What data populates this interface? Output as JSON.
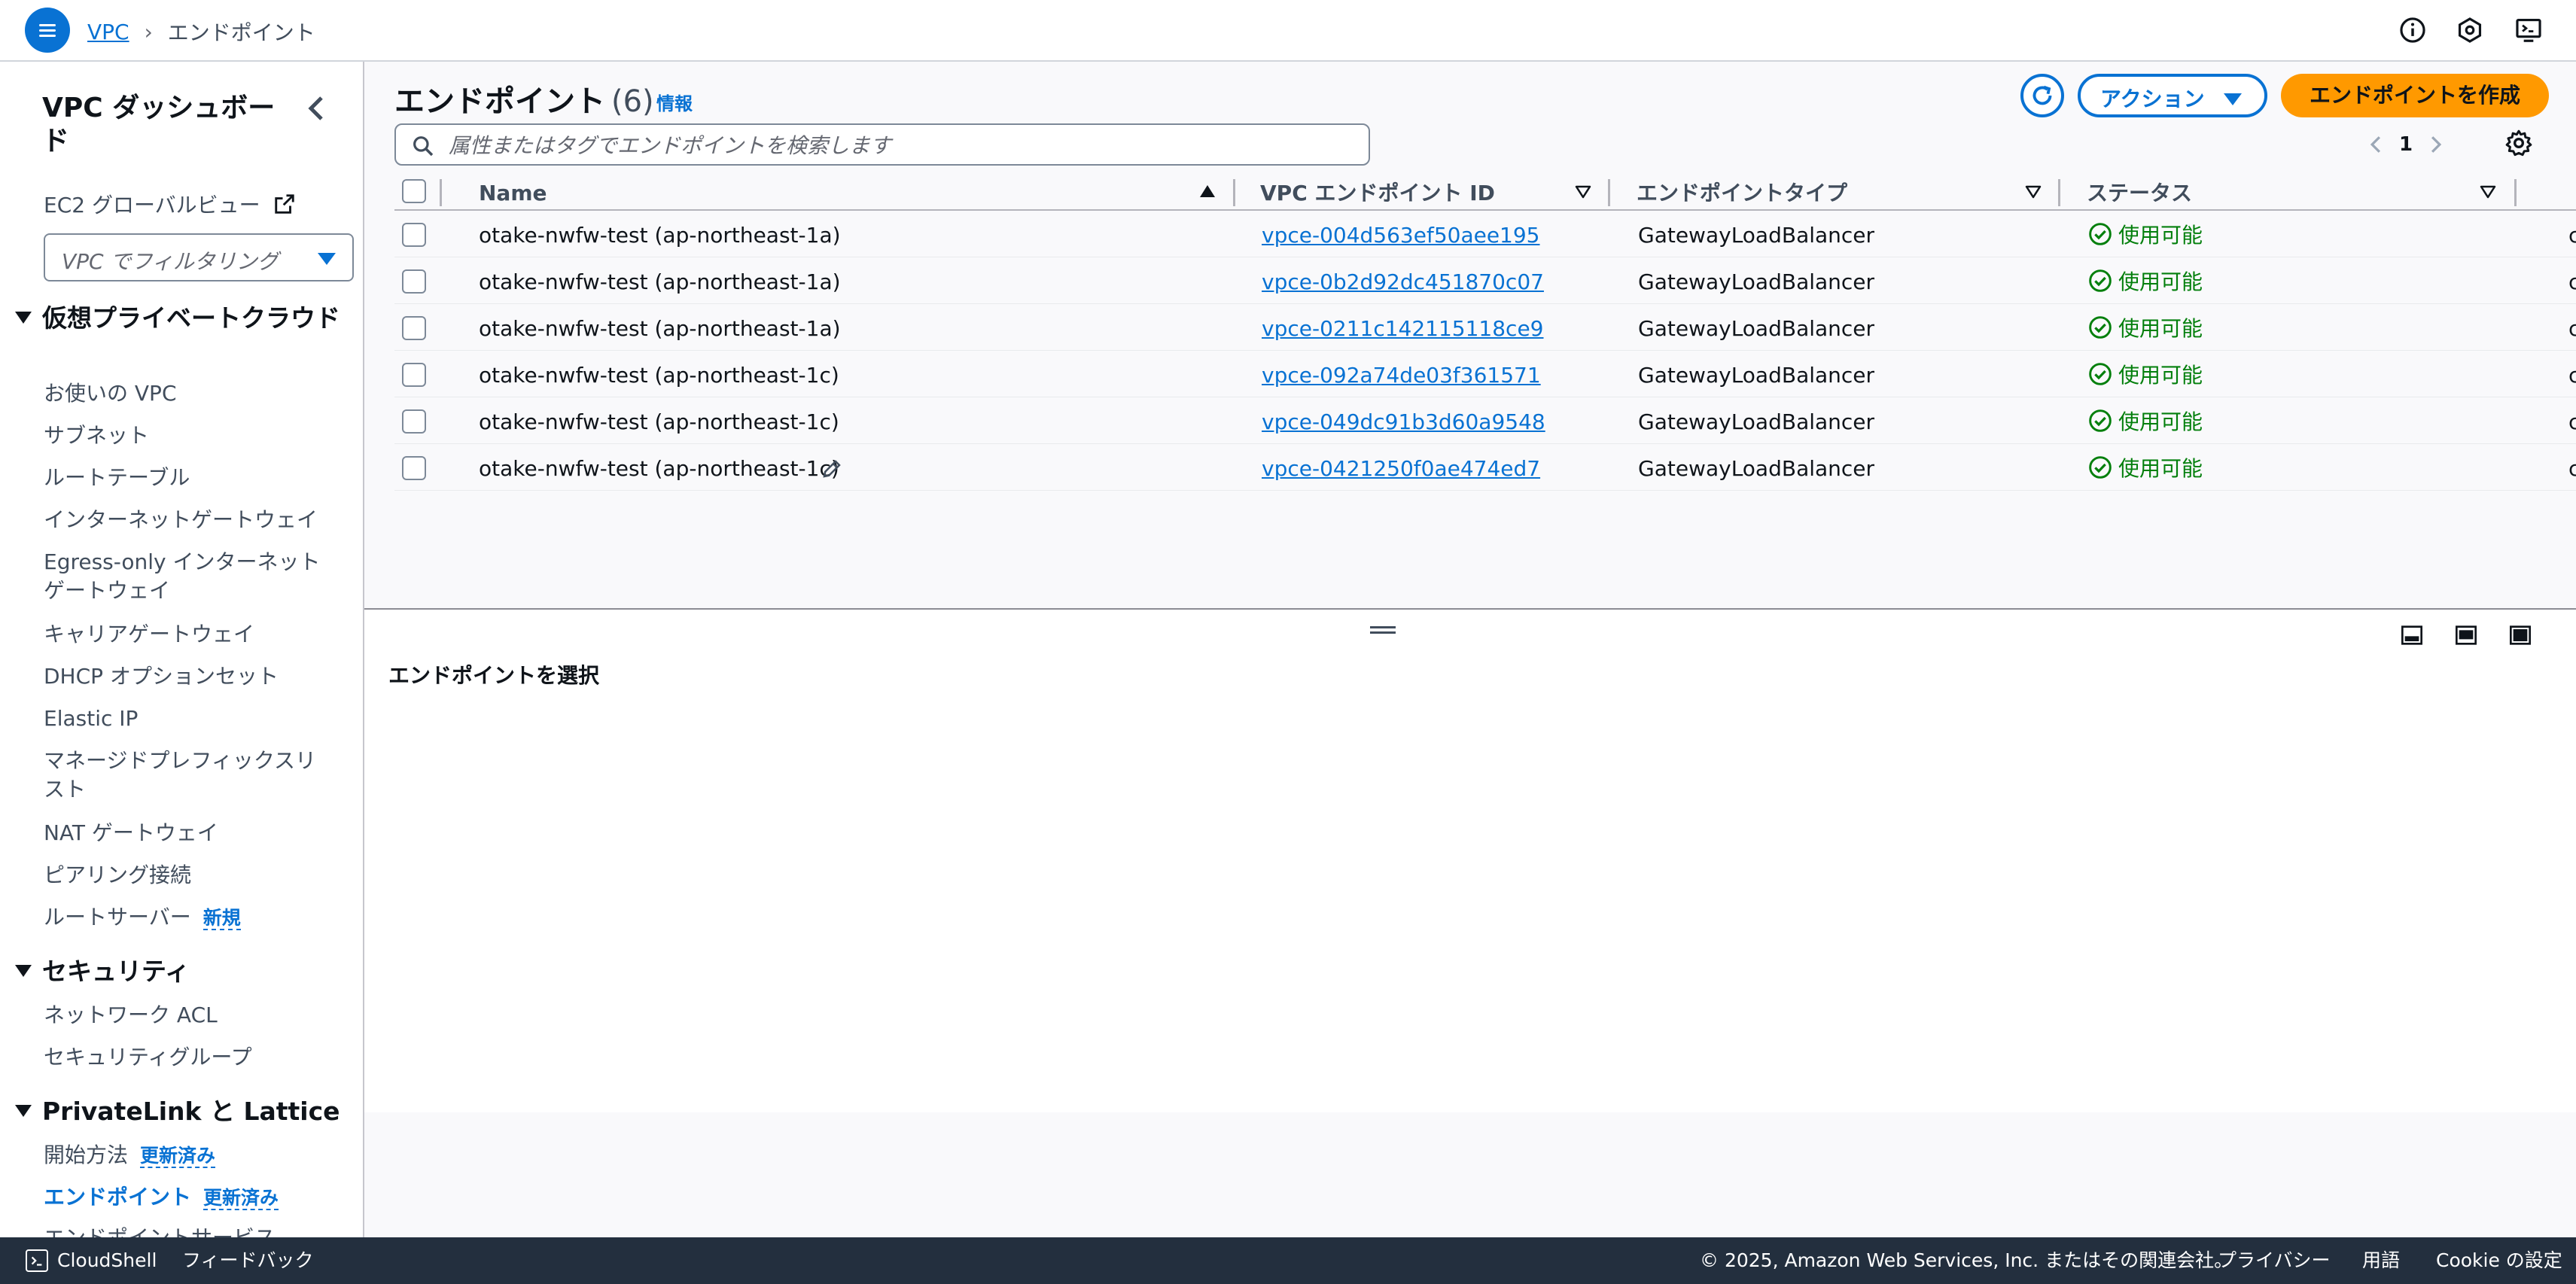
{
  "header": {
    "breadcrumb_root": "VPC",
    "breadcrumb_current": "エンドポイント",
    "icons": [
      "info-icon",
      "notifications-icon",
      "display-settings-icon"
    ]
  },
  "sidebar": {
    "title": "VPC ダッシュボード",
    "ec2_global_view": "EC2 グローバルビュー",
    "vpc_filter_placeholder": "VPC でフィルタリング",
    "sections": [
      {
        "title": "仮想プライベートクラウド",
        "items": [
          "お使いの VPC",
          "サブネット",
          "ルートテーブル",
          "インターネットゲートウェイ",
          "Egress-only インターネットゲートウェイ",
          "キャリアゲートウェイ",
          "DHCP オプションセット",
          "Elastic IP",
          "マネージドプレフィックスリスト",
          "NAT ゲートウェイ",
          "ピアリング接続",
          "ルートサーバー"
        ],
        "route_server_badge": "新規"
      },
      {
        "title": "セキュリティ",
        "items": [
          "ネットワーク ACL",
          "セキュリティグループ"
        ]
      },
      {
        "title": "PrivateLink と Lattice",
        "items": [
          "開始方法",
          "エンドポイント",
          "エンドポイントサービス"
        ],
        "updated_badge": "更新済み"
      }
    ]
  },
  "main": {
    "title": "エンドポイント",
    "count": "(6)",
    "info_link": "情報",
    "actions_label": "アクション",
    "create_label": "エンドポイントを作成",
    "search_placeholder": "属性またはタグでエンドポイントを検索します",
    "page_number": "1",
    "columns": [
      "Name",
      "VPC エンドポイント ID",
      "エンドポイントタイプ",
      "ステータス"
    ],
    "overflow_col_glyph": "c",
    "rows": [
      {
        "name": "otake-nwfw-test (ap-northeast-1a)",
        "id": "vpce-004d563ef50aee195",
        "type": "GatewayLoadBalancer",
        "status": "使用可能"
      },
      {
        "name": "otake-nwfw-test (ap-northeast-1a)",
        "id": "vpce-0b2d92dc451870c07",
        "type": "GatewayLoadBalancer",
        "status": "使用可能"
      },
      {
        "name": "otake-nwfw-test (ap-northeast-1a)",
        "id": "vpce-0211c142115118ce9",
        "type": "GatewayLoadBalancer",
        "status": "使用可能"
      },
      {
        "name": "otake-nwfw-test (ap-northeast-1c)",
        "id": "vpce-092a74de03f361571",
        "type": "GatewayLoadBalancer",
        "status": "使用可能"
      },
      {
        "name": "otake-nwfw-test (ap-northeast-1c)",
        "id": "vpce-049dc91b3d60a9548",
        "type": "GatewayLoadBalancer",
        "status": "使用可能"
      },
      {
        "name": "otake-nwfw-test (ap-northeast-1c)",
        "id": "vpce-0421250f0ae474ed7",
        "type": "GatewayLoadBalancer",
        "status": "使用可能"
      }
    ],
    "split_panel_title": "エンドポイントを選択"
  },
  "footer": {
    "cloudshell": "CloudShell",
    "feedback": "フィードバック",
    "copyright": "© 2025, Amazon Web Services, Inc. またはその関連会社。",
    "privacy": "プライバシー",
    "terms": "用語",
    "cookie": "Cookie の設定"
  },
  "colors": {
    "accent": "#0972d3",
    "primary_button": "#ff9900",
    "status_ok": "#037f0c",
    "footer_bg": "#232f3e"
  }
}
